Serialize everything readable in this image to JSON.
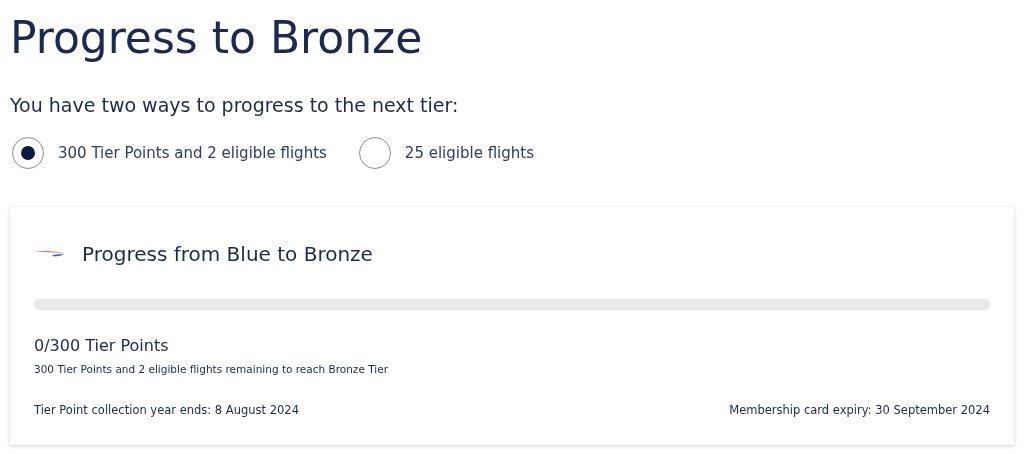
{
  "title": "Progress to Bronze",
  "subtitle": "You have two ways to progress to the next tier:",
  "options": [
    {
      "label": "300 Tier Points and 2 eligible flights",
      "selected": true
    },
    {
      "label": "25 eligible flights",
      "selected": false
    }
  ],
  "card": {
    "title": "Progress from Blue to Bronze",
    "progress": {
      "level": 0
    },
    "points": "0/300 Tier Points",
    "remaining": "300 Tier Points and 2 eligible flights remaining to reach Bronze Tier",
    "collection_year": "Tier Point collection year ends: 8 August 2024",
    "card_expiry": "Membership card expiry: 30 September 2024"
  }
}
